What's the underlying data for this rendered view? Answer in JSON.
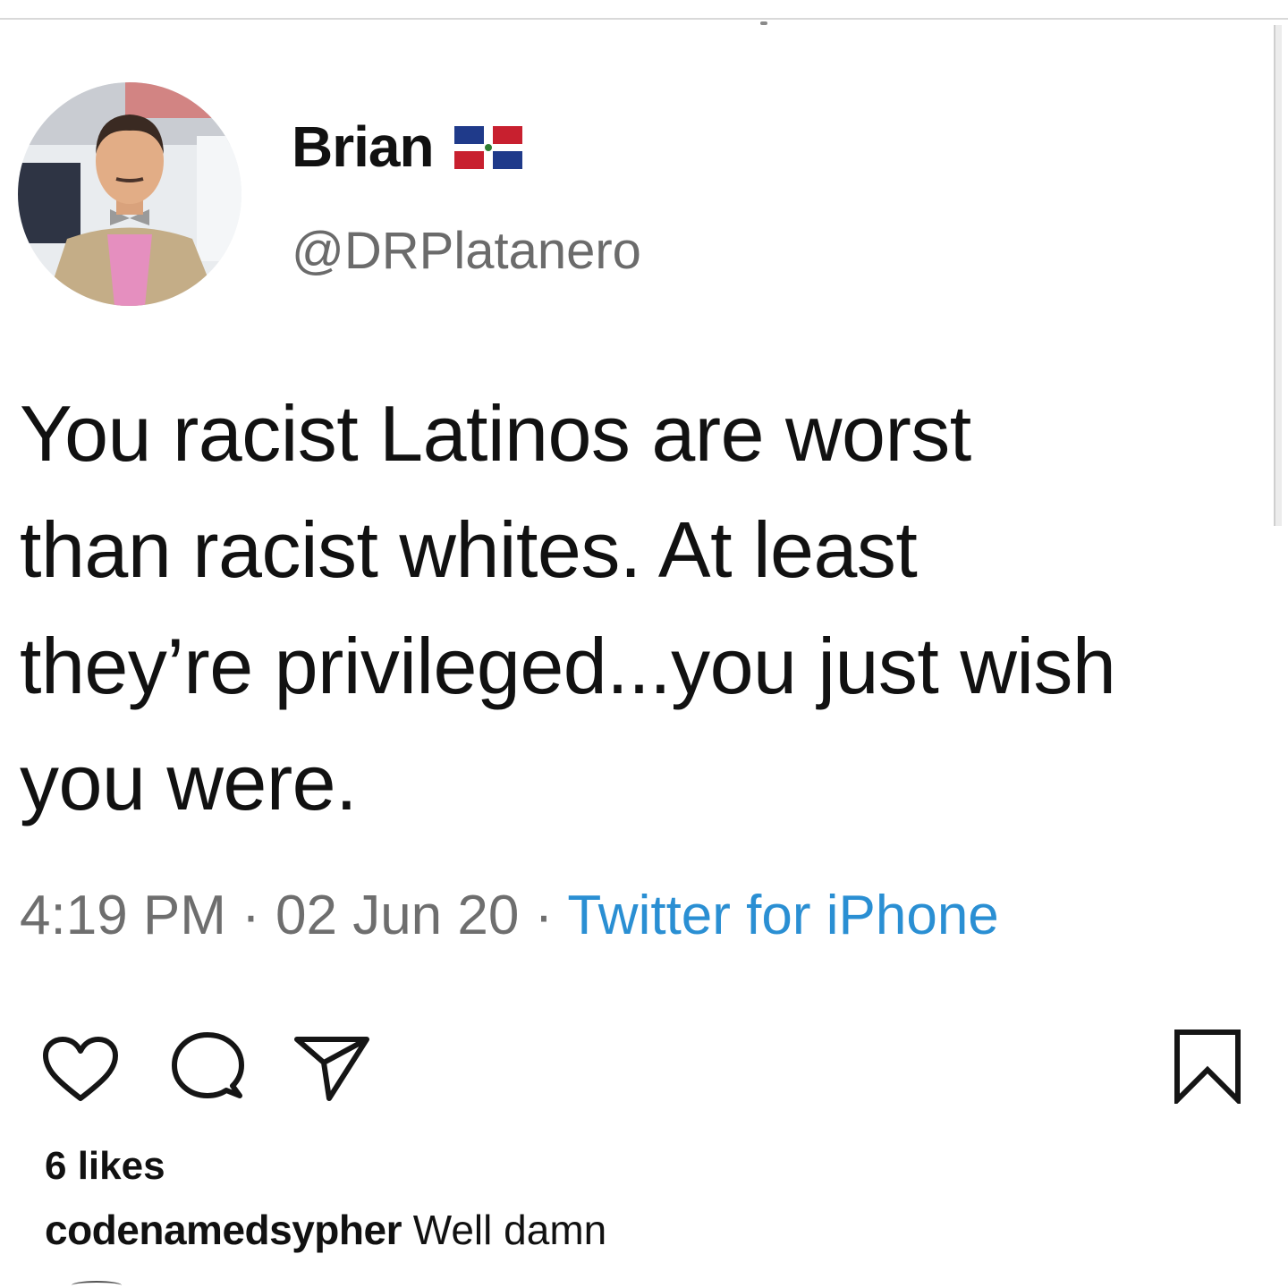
{
  "profile": {
    "display_name": "Brian",
    "handle": "@DRPlatanero",
    "flag_icon": "dominican-republic-flag-icon"
  },
  "tweet": {
    "lines": [
      "You racist Latinos are worst",
      "than racist whites. At least",
      "they’re privileged...you just wish",
      "you were."
    ],
    "time": "4:19 PM",
    "separator": " · ",
    "date": "02 Jun 20",
    "source": "Twitter for iPhone"
  },
  "actions": {
    "like_icon": "heart-icon",
    "comment_icon": "comment-icon",
    "share_icon": "send-icon",
    "bookmark_icon": "bookmark-icon"
  },
  "post": {
    "likes": "6 likes",
    "caption_user": "codenamedsypher",
    "caption_text": " Well damn"
  },
  "colors": {
    "text": "#111111",
    "muted": "#6e6e6e",
    "link": "#2a8fd3",
    "flag_blue": "#1f3a8a",
    "flag_red": "#c8202f"
  }
}
